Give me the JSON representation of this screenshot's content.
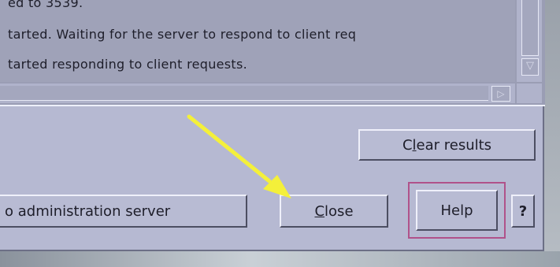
{
  "log": {
    "lines": [
      "ed to 3539.",
      "tarted. Waiting for the server to respond to client req",
      "tarted responding to client requests."
    ]
  },
  "buttons": {
    "clear_results": {
      "prefix": "C",
      "mnemonic": "l",
      "suffix": "ear results"
    },
    "go_admin": "o administration server",
    "close": {
      "mnemonic": "C",
      "suffix": "lose"
    },
    "help": "Help",
    "question": "?"
  },
  "scrollbar": {
    "down_arrow": "▽",
    "right_arrow": "▷"
  },
  "colors": {
    "annotation_arrow": "#f4f03a",
    "focus_ring": "#b0528a"
  }
}
